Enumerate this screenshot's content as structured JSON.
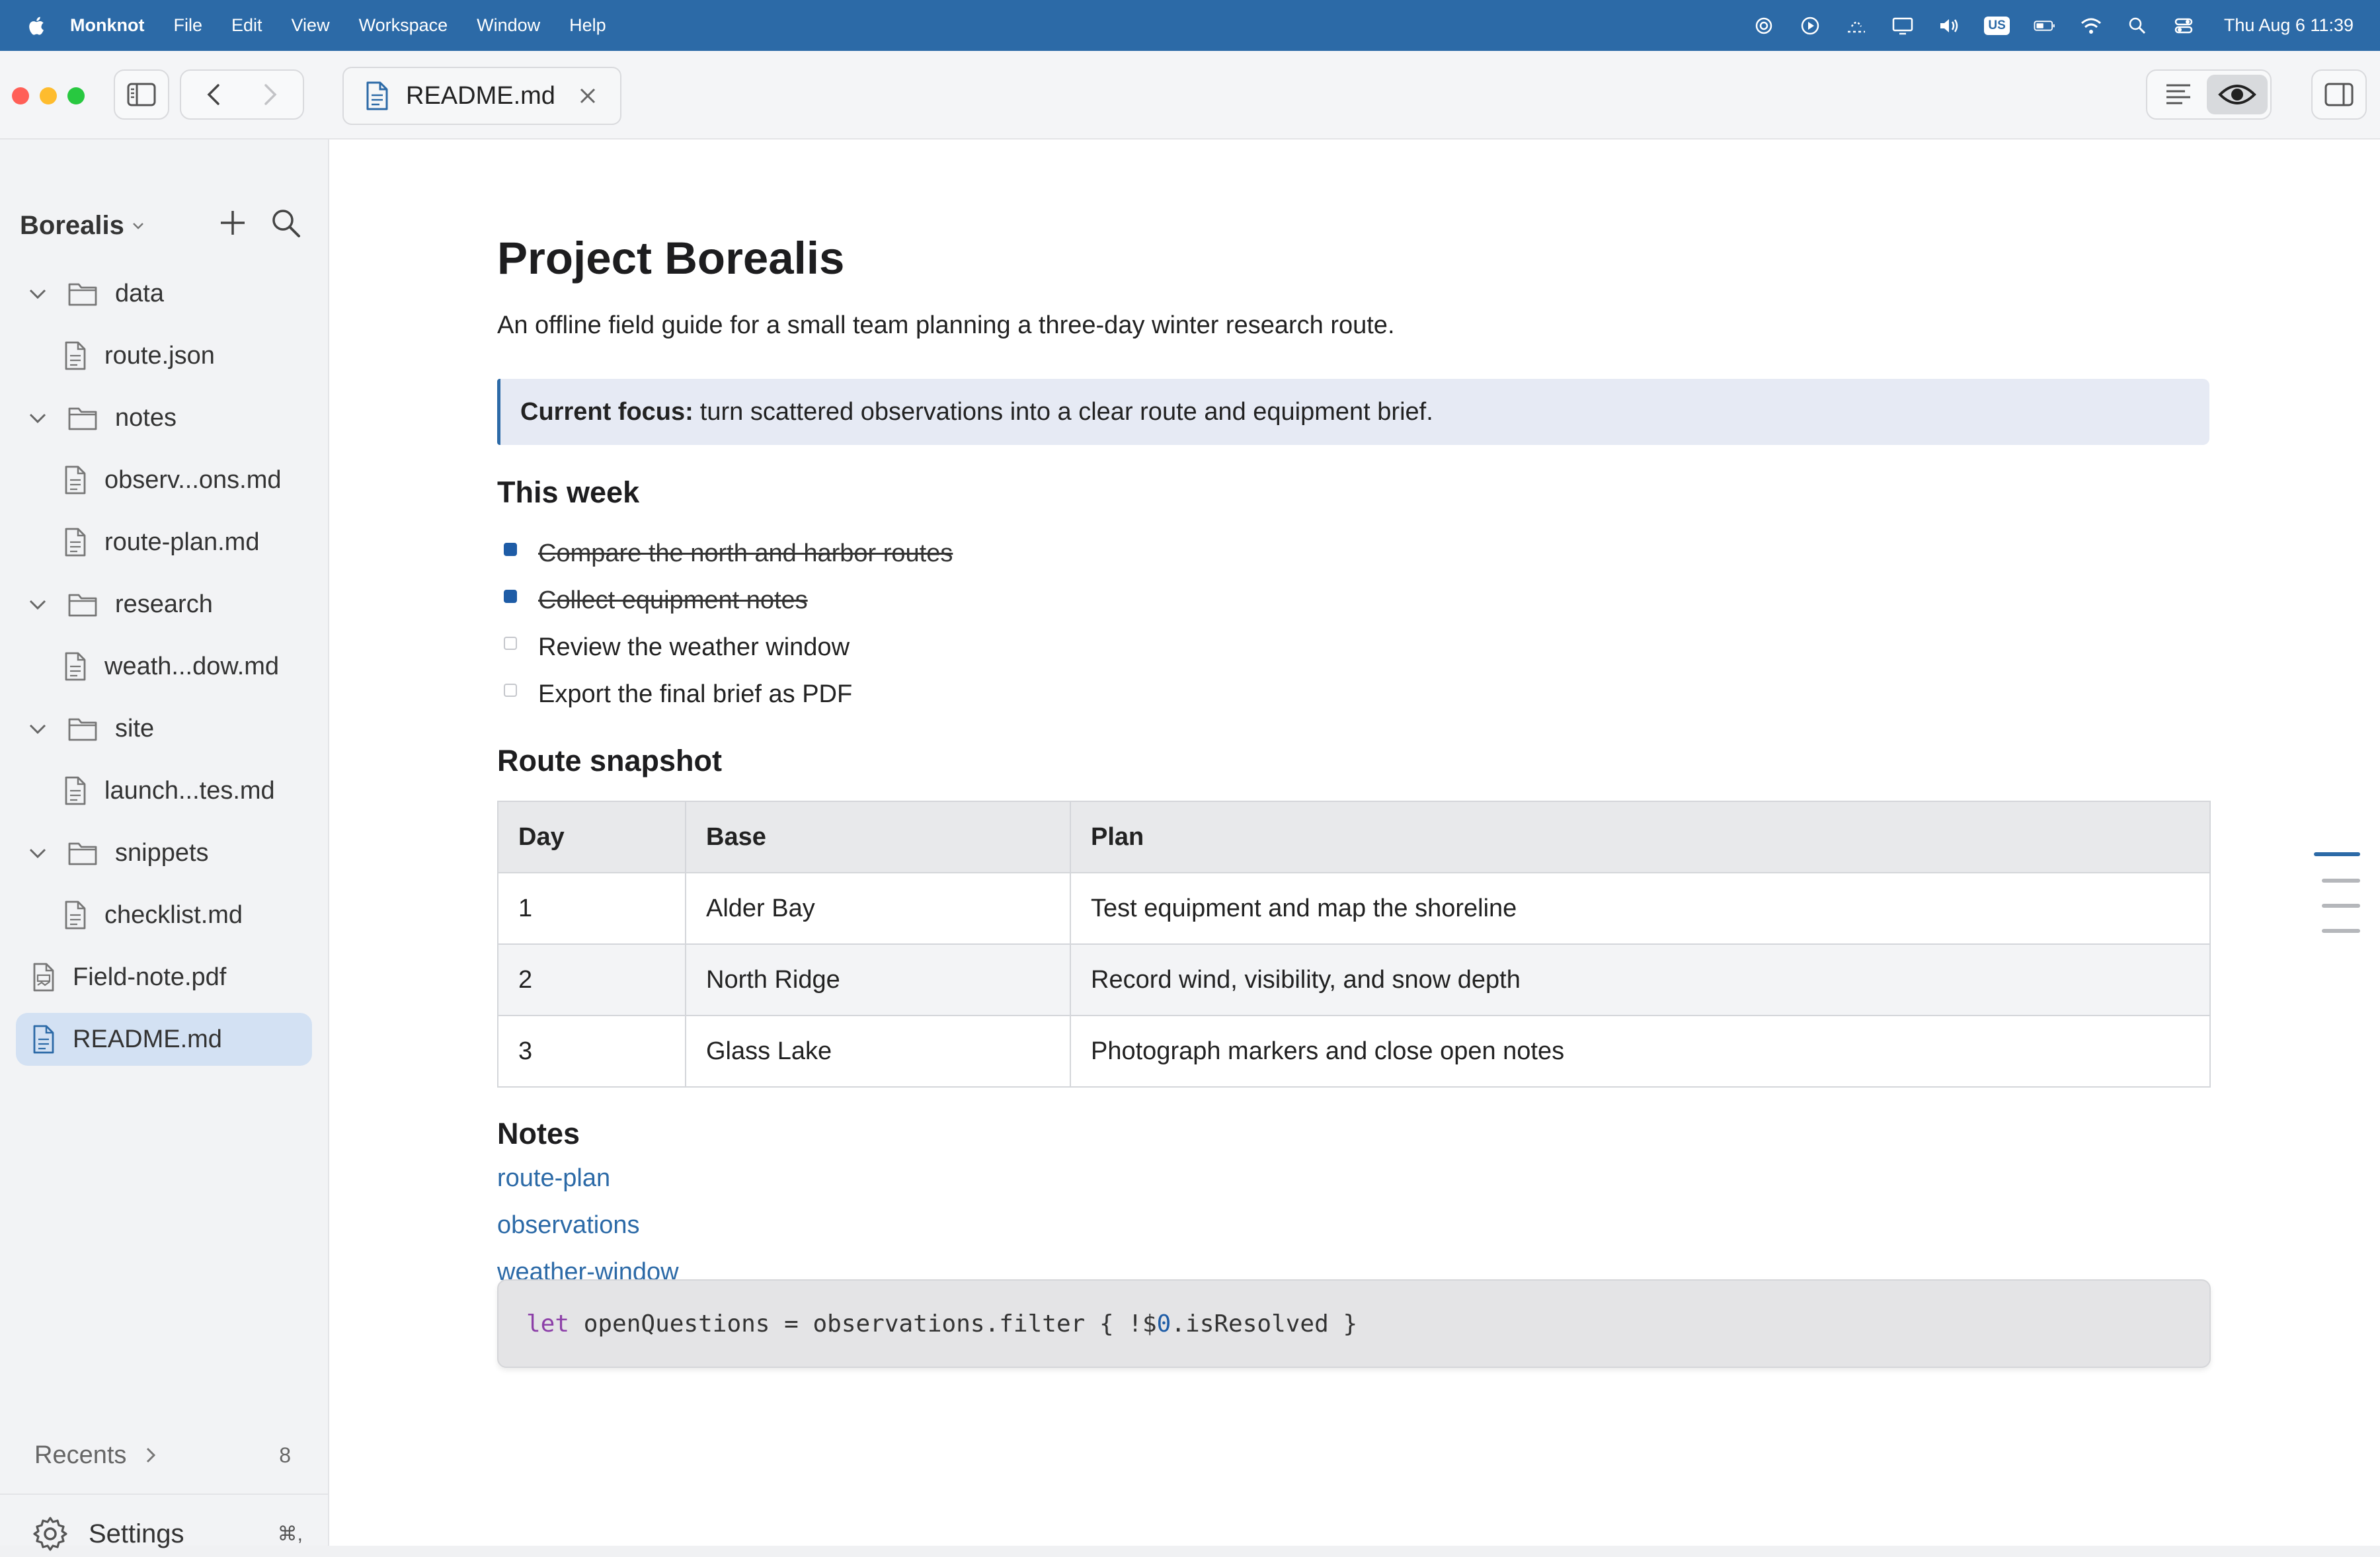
{
  "menubar": {
    "app_name": "Monknot",
    "menus": [
      "File",
      "Edit",
      "View",
      "Workspace",
      "Window",
      "Help"
    ],
    "keyboard_badge": "US",
    "clock": "Thu Aug 6  11:39"
  },
  "tab": {
    "label": "README.md"
  },
  "sidebar": {
    "vault_name": "Borealis",
    "tree": [
      {
        "type": "folder",
        "label": "data"
      },
      {
        "type": "file",
        "label": "route.json"
      },
      {
        "type": "folder",
        "label": "notes"
      },
      {
        "type": "file",
        "label": "observ...ons.md"
      },
      {
        "type": "file",
        "label": "route-plan.md"
      },
      {
        "type": "folder",
        "label": "research"
      },
      {
        "type": "file",
        "label": "weath...dow.md"
      },
      {
        "type": "folder",
        "label": "site"
      },
      {
        "type": "file",
        "label": "launch...tes.md"
      },
      {
        "type": "folder",
        "label": "snippets"
      },
      {
        "type": "file",
        "label": "checklist.md"
      },
      {
        "type": "pdf",
        "label": "Field-note.pdf"
      },
      {
        "type": "file",
        "label": "README.md"
      }
    ],
    "recents_label": "Recents",
    "recents_count": "8",
    "settings_label": "Settings",
    "settings_shortcut": "⌘,"
  },
  "doc": {
    "title": "Project Borealis",
    "subtitle": "An offline field guide for a small team planning a three-day winter research route.",
    "callout_bold": "Current focus:",
    "callout_text": "turn scattered observations into a clear route and equipment brief.",
    "week_heading": "This week",
    "tasks": [
      {
        "label": "Compare the north and harbor routes",
        "done": true
      },
      {
        "label": "Collect equipment notes",
        "done": true
      },
      {
        "label": "Review the weather window",
        "done": false
      },
      {
        "label": "Export the final brief as PDF",
        "done": false
      }
    ],
    "route_heading": "Route snapshot",
    "table": {
      "headers": [
        "Day",
        "Base",
        "Plan"
      ],
      "rows": [
        [
          "1",
          "Alder Bay",
          "Test equipment and map the shoreline"
        ],
        [
          "2",
          "North Ridge",
          "Record wind, visibility, and snow depth"
        ],
        [
          "3",
          "Glass Lake",
          "Photograph markers and close open notes"
        ]
      ]
    },
    "notes_heading": "Notes",
    "links": [
      "route-plan",
      "observations",
      "weather-window"
    ],
    "code": {
      "keyword": "let",
      "before_num": " openQuestions = observations.filter { !$",
      "num": "0",
      "after_num": ".isResolved }"
    }
  },
  "colors": {
    "accent": "#2c6aa7",
    "checkbox_checked": "#1e5ca6",
    "sidebar_active": "#d3e1f3",
    "callout_bg": "#e6eaf4"
  }
}
